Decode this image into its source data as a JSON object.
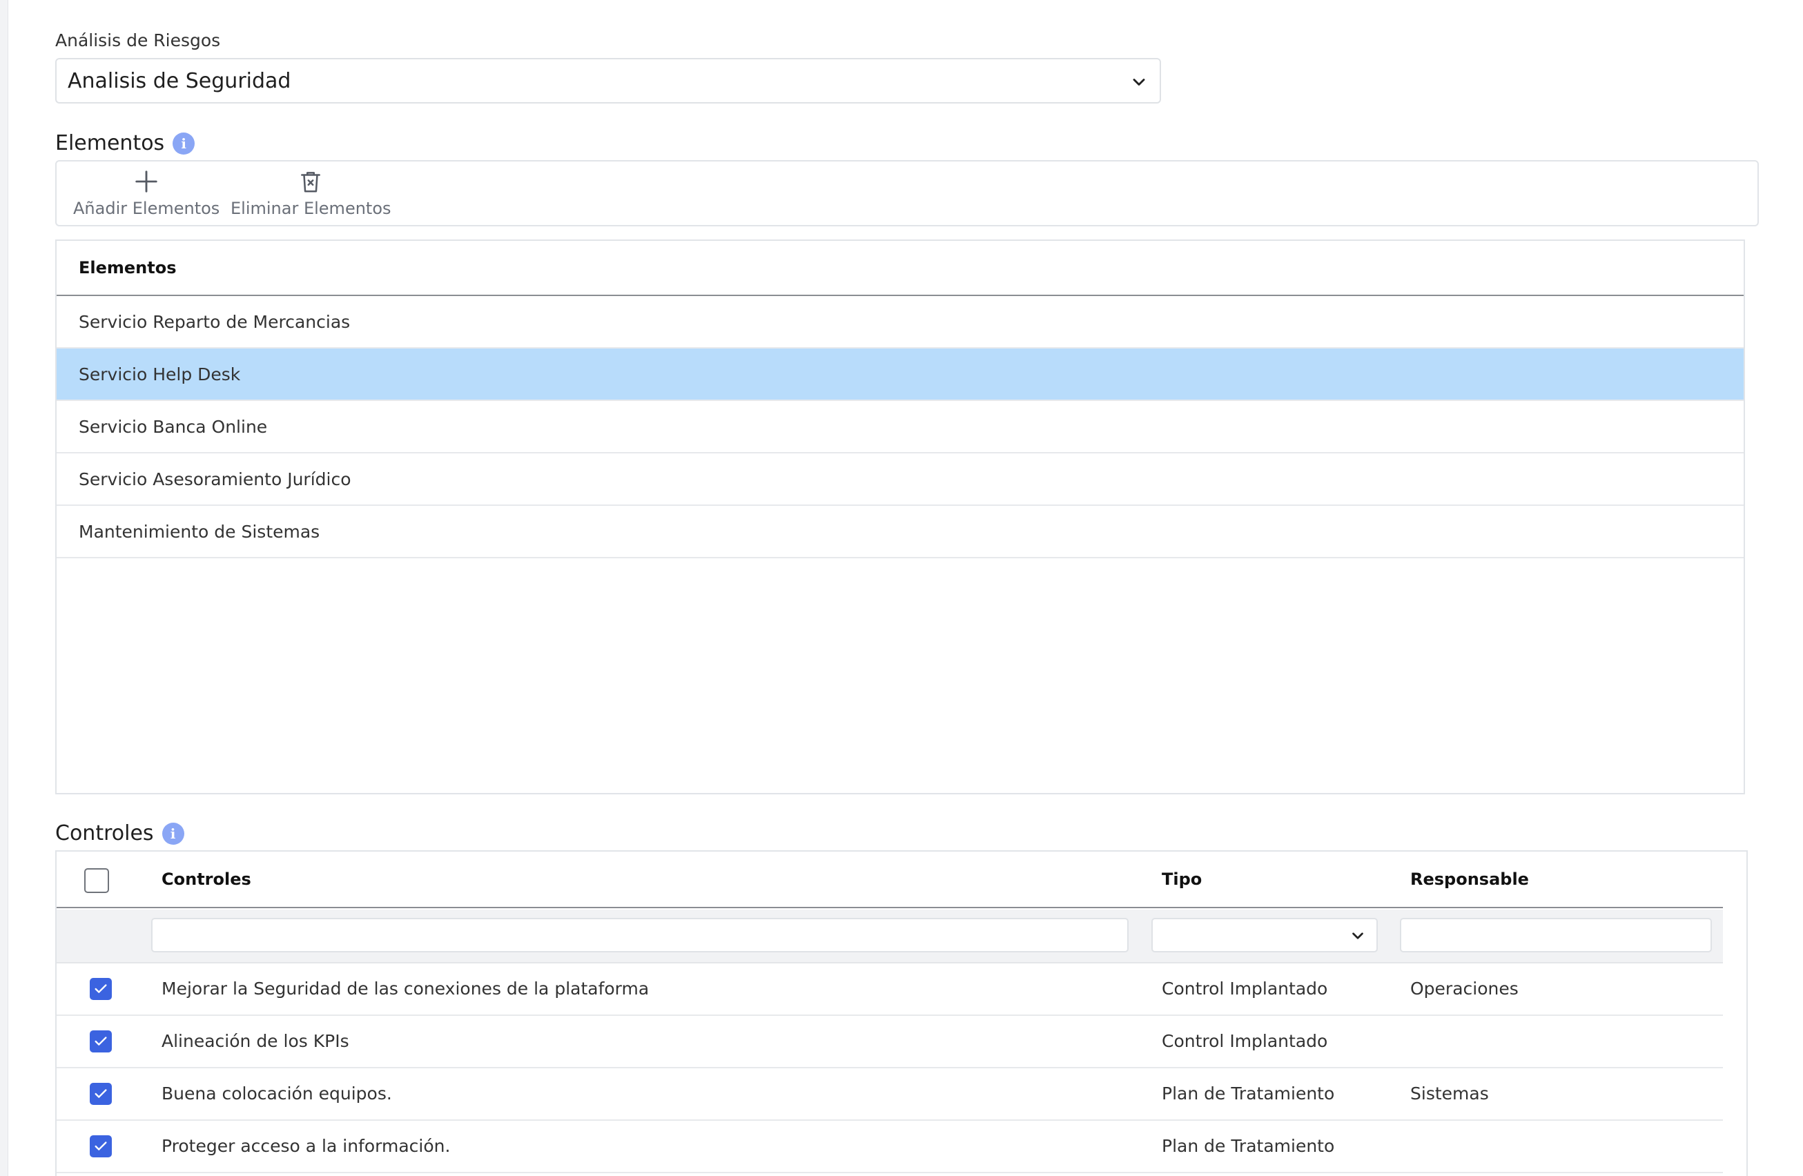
{
  "risk": {
    "label": "Análisis de Riesgos",
    "selected": "Analisis de Seguridad"
  },
  "elements_section": {
    "title": "Elementos",
    "toolbar": {
      "add_label": "Añadir Elementos",
      "delete_label": "Eliminar Elementos"
    },
    "table": {
      "header": "Elementos",
      "rows": [
        "Servicio Reparto de Mercancias",
        "Servicio Help Desk",
        "Servicio Banca Online",
        "Servicio Asesoramiento Jurídico",
        "Mantenimiento de Sistemas"
      ],
      "selected_row": "Servicio Help Desk"
    }
  },
  "controls_section": {
    "title": "Controles",
    "columns": {
      "controles": "Controles",
      "tipo": "Tipo",
      "responsable": "Responsable"
    },
    "rows": [
      {
        "control": "Mejorar la Seguridad de las conexiones de la plataforma",
        "tipo": "Control Implantado",
        "responsable": "Operaciones",
        "checked": true
      },
      {
        "control": "Alineación de los KPIs",
        "tipo": "Control Implantado",
        "responsable": "",
        "checked": true
      },
      {
        "control": "Buena colocación equipos.",
        "tipo": "Plan de Tratamiento",
        "responsable": "Sistemas",
        "checked": true
      },
      {
        "control": "Proteger acceso a la información.",
        "tipo": "Plan de Tratamiento",
        "responsable": "",
        "checked": true
      }
    ]
  },
  "icons": {
    "dropdown": "chevron-down-icon",
    "info": "info-icon",
    "add": "plus-icon",
    "delete": "trash-icon",
    "checkbox": "checkmark-icon"
  },
  "colors": {
    "selected_row": "#b8dcfb",
    "checkbox": "#3b63e0",
    "info": "#8aa6f5"
  }
}
